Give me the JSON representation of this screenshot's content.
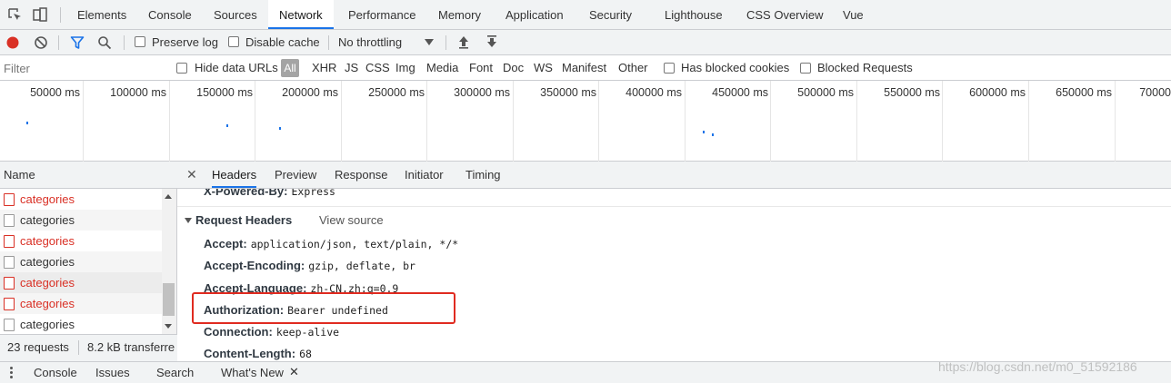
{
  "tabs": [
    "Elements",
    "Console",
    "Sources",
    "Network",
    "Performance",
    "Memory",
    "Application",
    "Security",
    "Lighthouse",
    "CSS Overview",
    "Vue"
  ],
  "active_tab": "Network",
  "toolbar": {
    "preserve_log": "Preserve log",
    "disable_cache": "Disable cache",
    "throttling": "No throttling"
  },
  "filter": {
    "placeholder": "Filter",
    "hide_data_urls": "Hide data URLs",
    "all": "All",
    "types": [
      "XHR",
      "JS",
      "CSS",
      "Img",
      "Media",
      "Font",
      "Doc",
      "WS",
      "Manifest",
      "Other"
    ],
    "has_blocked_cookies": "Has blocked cookies",
    "blocked_requests": "Blocked Requests"
  },
  "overview": {
    "ticks": [
      "50000 ms",
      "100000 ms",
      "150000 ms",
      "200000 ms",
      "250000 ms",
      "300000 ms",
      "350000 ms",
      "400000 ms",
      "450000 ms",
      "500000 ms",
      "550000 ms",
      "600000 ms",
      "650000 ms",
      "70000"
    ]
  },
  "requests": {
    "header": "Name",
    "rows": [
      {
        "name": "categories",
        "status": "error"
      },
      {
        "name": "categories",
        "status": "ok"
      },
      {
        "name": "categories",
        "status": "error"
      },
      {
        "name": "categories",
        "status": "ok"
      },
      {
        "name": "categories",
        "status": "error"
      },
      {
        "name": "categories",
        "status": "error"
      },
      {
        "name": "categories",
        "status": "ok"
      }
    ],
    "count": "23 requests",
    "transferred": "8.2 kB transferre"
  },
  "details": {
    "tabs": [
      "Headers",
      "Preview",
      "Response",
      "Initiator",
      "Timing"
    ],
    "active_tab": "Headers",
    "partial_header": {
      "name": "X-Powered-By:",
      "value": "Express"
    },
    "section_title": "Request Headers",
    "view_source": "View source",
    "headers": [
      {
        "name": "Accept:",
        "value": "application/json, text/plain, */*"
      },
      {
        "name": "Accept-Encoding:",
        "value": "gzip, deflate, br"
      },
      {
        "name": "Accept-Language:",
        "value": "zh-CN,zh;q=0.9"
      },
      {
        "name": "Authorization:",
        "value": "Bearer undefined"
      },
      {
        "name": "Connection:",
        "value": "keep-alive"
      },
      {
        "name": "Content-Length:",
        "value": "68"
      }
    ]
  },
  "drawer": {
    "tabs": [
      "Console",
      "Issues",
      "Search",
      "What's New"
    ]
  },
  "watermark": "https://blog.csdn.net/m0_51592186",
  "colors": {
    "accent": "#1a73e8",
    "record": "#d93025",
    "error_text": "#d93025",
    "highlight_box": "#e02b20"
  }
}
